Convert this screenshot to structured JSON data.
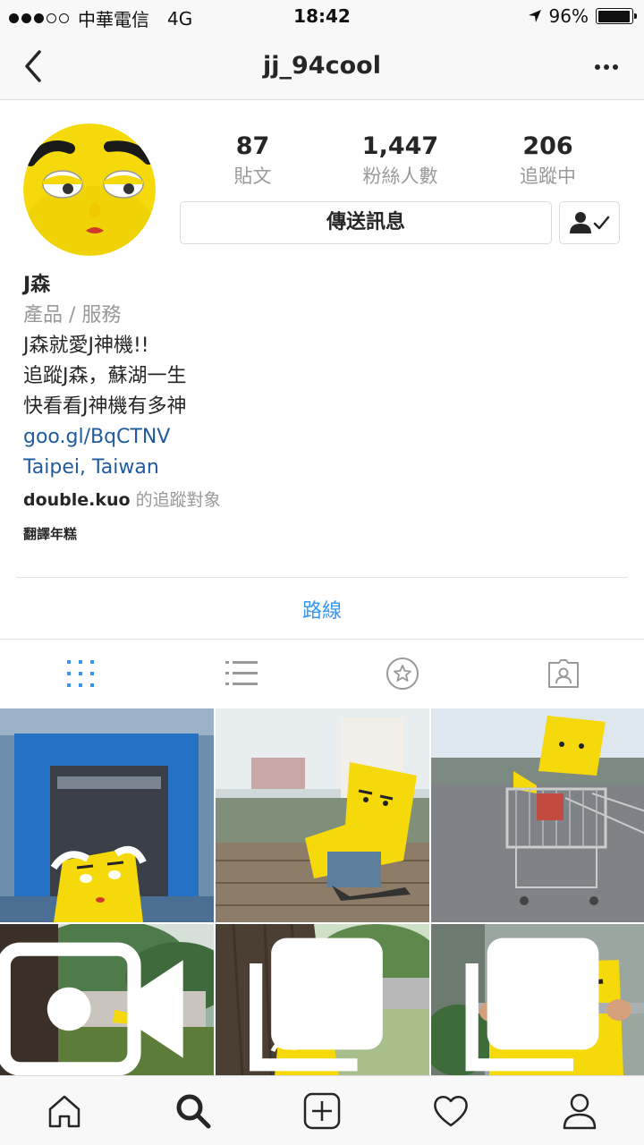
{
  "status_bar": {
    "carrier": "中華電信",
    "network": "4G",
    "time": "18:42",
    "battery": "96%",
    "battery_level": 0.96,
    "signal_bars_filled": 3,
    "signal_bars_total": 5
  },
  "nav": {
    "back_icon": "chevron-left-icon",
    "title": "jj_94cool",
    "more_icon": "more-horizontal-icon"
  },
  "profile": {
    "stats": [
      {
        "value": "87",
        "label": "貼文"
      },
      {
        "value": "1,447",
        "label": "粉絲人數"
      },
      {
        "value": "206",
        "label": "追蹤中"
      }
    ],
    "message_button": "傳送訊息",
    "follow_icon": "person-check-icon"
  },
  "bio": {
    "name": "J森",
    "category": "產品 / 服務",
    "lines": [
      "J森就愛J神機!!",
      "追蹤J森，蘇湖一生",
      "快看看J神機有多神"
    ],
    "link": "goo.gl/BqCTNV",
    "location": "Taipei, Taiwan",
    "followed_by_user": "double.kuo",
    "followed_by_suffix": " 的追蹤對象",
    "translate": "翻譯年糕"
  },
  "directions": "路線",
  "tabs": [
    {
      "icon": "grid-icon",
      "active": true
    },
    {
      "icon": "list-icon",
      "active": false
    },
    {
      "icon": "star-icon",
      "active": false
    },
    {
      "icon": "tagged-icon",
      "active": false
    }
  ],
  "posts": [
    {
      "badge": ""
    },
    {
      "badge": ""
    },
    {
      "badge": ""
    },
    {
      "badge": "video-icon"
    },
    {
      "badge": "multiple-icon"
    },
    {
      "badge": "multiple-icon"
    }
  ],
  "bottom_nav": [
    "home-icon",
    "search-icon",
    "add-icon",
    "heart-icon",
    "profile-icon"
  ],
  "colors": {
    "link": "#1f5b9e",
    "accent": "#3897f0",
    "mascot_yellow": "#f5d90a"
  }
}
